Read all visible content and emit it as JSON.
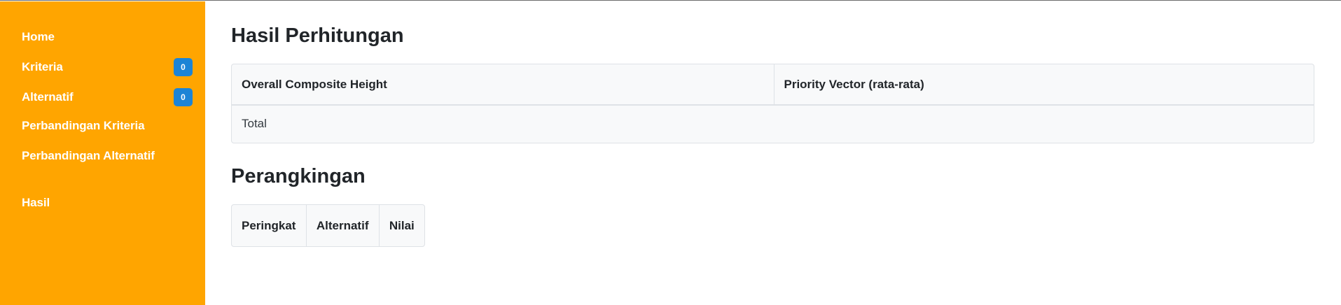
{
  "sidebar": {
    "items": [
      {
        "label": "Home",
        "badge": null
      },
      {
        "label": "Kriteria",
        "badge": "0"
      },
      {
        "label": "Alternatif",
        "badge": "0"
      },
      {
        "label": "Perbandingan Kriteria",
        "badge": null
      },
      {
        "label": "Perbandingan Alternatif",
        "badge": null
      },
      {
        "label": "Hasil",
        "badge": null
      }
    ]
  },
  "hasil": {
    "title": "Hasil Perhitungan",
    "columns": [
      "Overall Composite Height",
      "Priority Vector (rata-rata)"
    ],
    "rows": [
      [
        "Total",
        ""
      ]
    ]
  },
  "ranking": {
    "title": "Perangkingan",
    "columns": [
      "Peringkat",
      "Alternatif",
      "Nilai"
    ]
  },
  "colors": {
    "sidebar_bg": "#ffa500",
    "badge_bg": "#1c84d6",
    "table_bg": "#f8f9fa"
  }
}
